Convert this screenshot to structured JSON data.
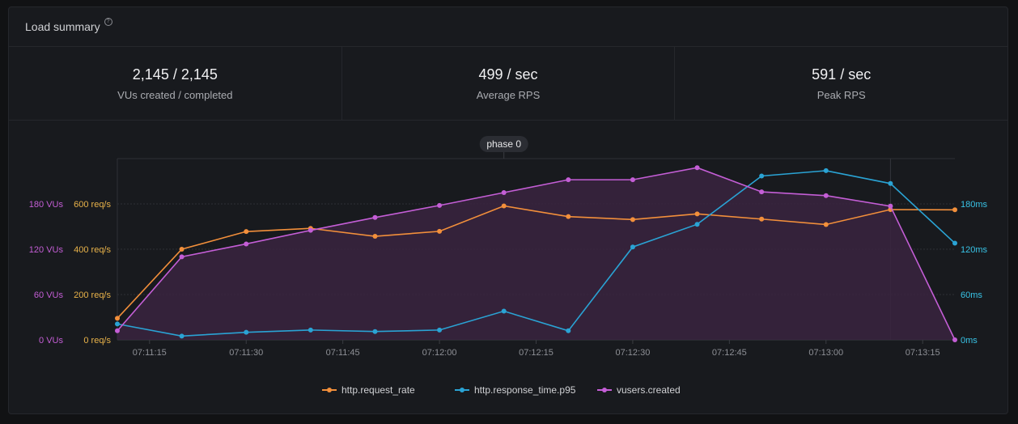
{
  "header": {
    "title": "Load summary",
    "help_icon": "help-circle-icon"
  },
  "stats": [
    {
      "value": "2,145 / 2,145",
      "label": "VUs created / completed"
    },
    {
      "value": "499 / sec",
      "label": "Average RPS"
    },
    {
      "value": "591 / sec",
      "label": "Peak RPS"
    }
  ],
  "colors": {
    "request_rate": "#f28f3b",
    "response_time": "#2aa3d4",
    "vusers": "#c45ed6",
    "vusers_fill": "#3a2440"
  },
  "chart_data": {
    "type": "line",
    "x": [
      "07:11:10",
      "07:11:20",
      "07:11:30",
      "07:11:40",
      "07:11:50",
      "07:12:00",
      "07:12:10",
      "07:12:20",
      "07:12:30",
      "07:12:40",
      "07:12:50",
      "07:13:00",
      "07:13:10",
      "07:13:20"
    ],
    "x_ticks": [
      "07:11:15",
      "07:11:30",
      "07:11:45",
      "07:12:00",
      "07:12:15",
      "07:12:30",
      "07:12:45",
      "07:13:00",
      "07:13:15"
    ],
    "phase_label": "phase 0",
    "phase_x": "07:12:10",
    "phase_end_x": "07:13:10",
    "axes": {
      "vus": {
        "ticks": [
          "0 VUs",
          "60 VUs",
          "120 VUs",
          "180 VUs"
        ],
        "values": [
          0,
          60,
          120,
          180
        ]
      },
      "req": {
        "ticks": [
          "0 req/s",
          "200 req/s",
          "400 req/s",
          "600 req/s"
        ],
        "values": [
          0,
          200,
          400,
          600
        ]
      },
      "ms": {
        "ticks": [
          "0ms",
          "60ms",
          "120ms",
          "180ms"
        ],
        "values": [
          0,
          60,
          120,
          180
        ]
      }
    },
    "series": [
      {
        "name": "http.request_rate",
        "axis": "req",
        "values": [
          95,
          400,
          478,
          492,
          457,
          479,
          591,
          544,
          531,
          556,
          533,
          509,
          575,
          574
        ]
      },
      {
        "name": "http.response_time.p95",
        "axis": "ms",
        "values": [
          21,
          5,
          10,
          13,
          11,
          13,
          38,
          12,
          123,
          153,
          217,
          224,
          207,
          128
        ]
      },
      {
        "name": "vusers.created",
        "axis": "vus",
        "values": [
          12,
          110,
          127,
          145,
          162,
          178,
          195,
          212,
          212,
          228,
          196,
          191,
          177,
          0
        ]
      }
    ],
    "grid": true,
    "legend_position": "bottom"
  }
}
